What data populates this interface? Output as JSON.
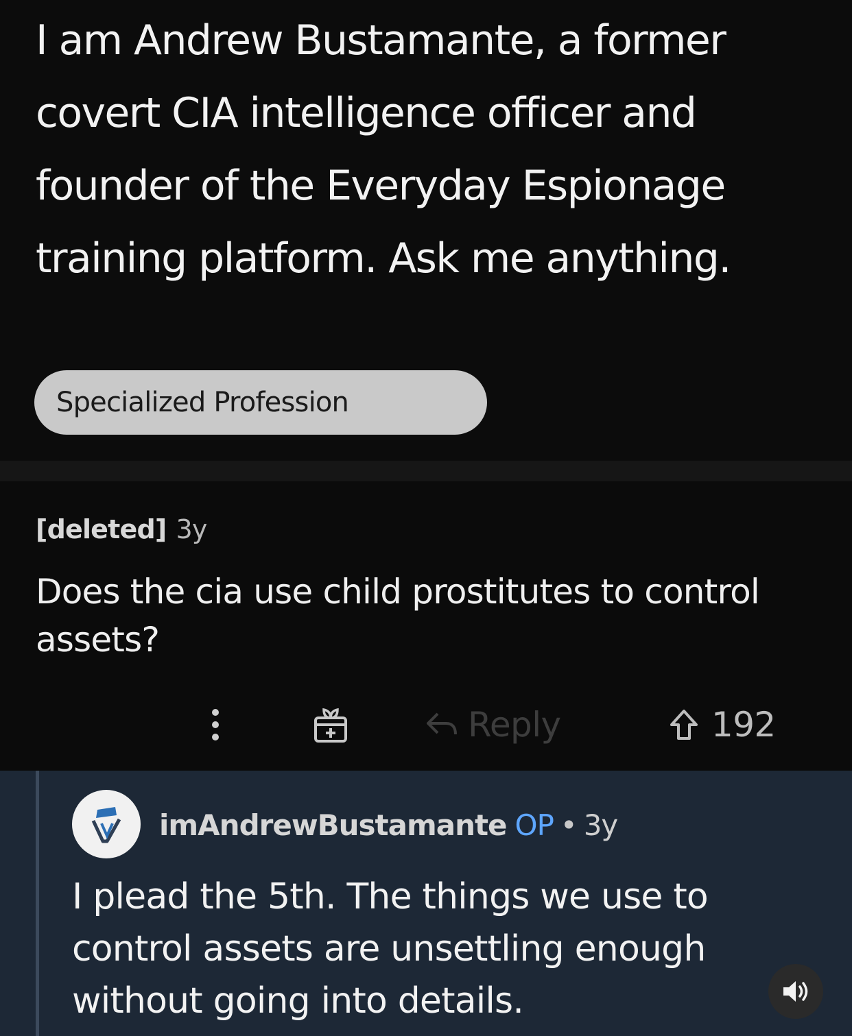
{
  "post": {
    "title": "I am Andrew Bustamante, a former covert CIA intelligence officer and founder of the Everyday Espionage training platform. Ask me anything.",
    "flair": "Specialized Profession"
  },
  "comment": {
    "author": "[deleted]",
    "age": "3y",
    "body": "Does the cia use child prostitutes to control assets?",
    "actions": {
      "more_icon": "vertical-dots-icon",
      "award_icon": "gift-award-icon",
      "reply_icon": "reply-arrow-icon",
      "reply_label": "Reply",
      "upvote_icon": "upvote-arrow-icon",
      "upvotes": "192"
    }
  },
  "reply": {
    "author": "imAndrewBustamante",
    "op_badge": "OP",
    "separator": "•",
    "age": "3y",
    "body": "I plead the 5th. The things we use to control assets are unsettling enough without going into details."
  },
  "controls": {
    "sound_icon": "speaker-icon"
  },
  "colors": {
    "background": "#0c0c0c",
    "reply_background": "#1d2836",
    "op_badge": "#5ea6ff",
    "flair_background": "#c9c9c9"
  }
}
